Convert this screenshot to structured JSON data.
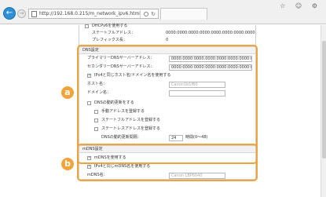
{
  "browser": {
    "back_label": "←",
    "forward_label": "→",
    "url": "http://192.168.0.215/m_network_ipv6.html",
    "refresh_label": "↻",
    "window_controls": "☆ ☺ ⚙"
  },
  "top_section": {
    "dhcp_label": "DHCPv6を使用する",
    "stateful_label": "ステートフルアドレス：",
    "stateful_value": "0000:0000:0000:0000:0000:0000:0000:0000",
    "prefix_label": "プレフィックス長：",
    "prefix_value": "0"
  },
  "dns": {
    "title": "DNS設定",
    "primary_label": "プライマリーDNSサーバーアドレス：",
    "primary_value": "0000:0000:0000:0000:0000:0000:0000:0000",
    "secondary_label": "セカンダリーDNSサーバーアドレス：",
    "secondary_value": "0000:0000:0000:0000:0000:0000:0000:0000",
    "same_host_label": "IPv4と同じホスト名/ドメイン名を使用する",
    "host_label": "ホスト名：",
    "host_placeholder": "Canon1b1f60",
    "domain_label": "ドメイン名：",
    "domain_value": "",
    "ddns_label": "DNSの動的更新をする",
    "manual_label": "手動アドレスを登録する",
    "stateful_reg_label": "ステートフルアドレスを登録する",
    "stateless_reg_label": "ステートレスアドレスを登録する",
    "interval_label": "DNSの動的更新間隔：",
    "interval_value": "24",
    "interval_unit": "時間(0～48)"
  },
  "mdns": {
    "title": "mDNS設定",
    "use_label": "mDNSを使用する",
    "same_label": "IPv4と同じmDNS名を使用する",
    "name_label": "mDNS名：",
    "name_placeholder": "Canon LBP6040"
  },
  "callouts": {
    "a": "a",
    "b": "b"
  },
  "colors": {
    "highlight": "#f2a33a",
    "back_button": "#2f8fd6"
  }
}
